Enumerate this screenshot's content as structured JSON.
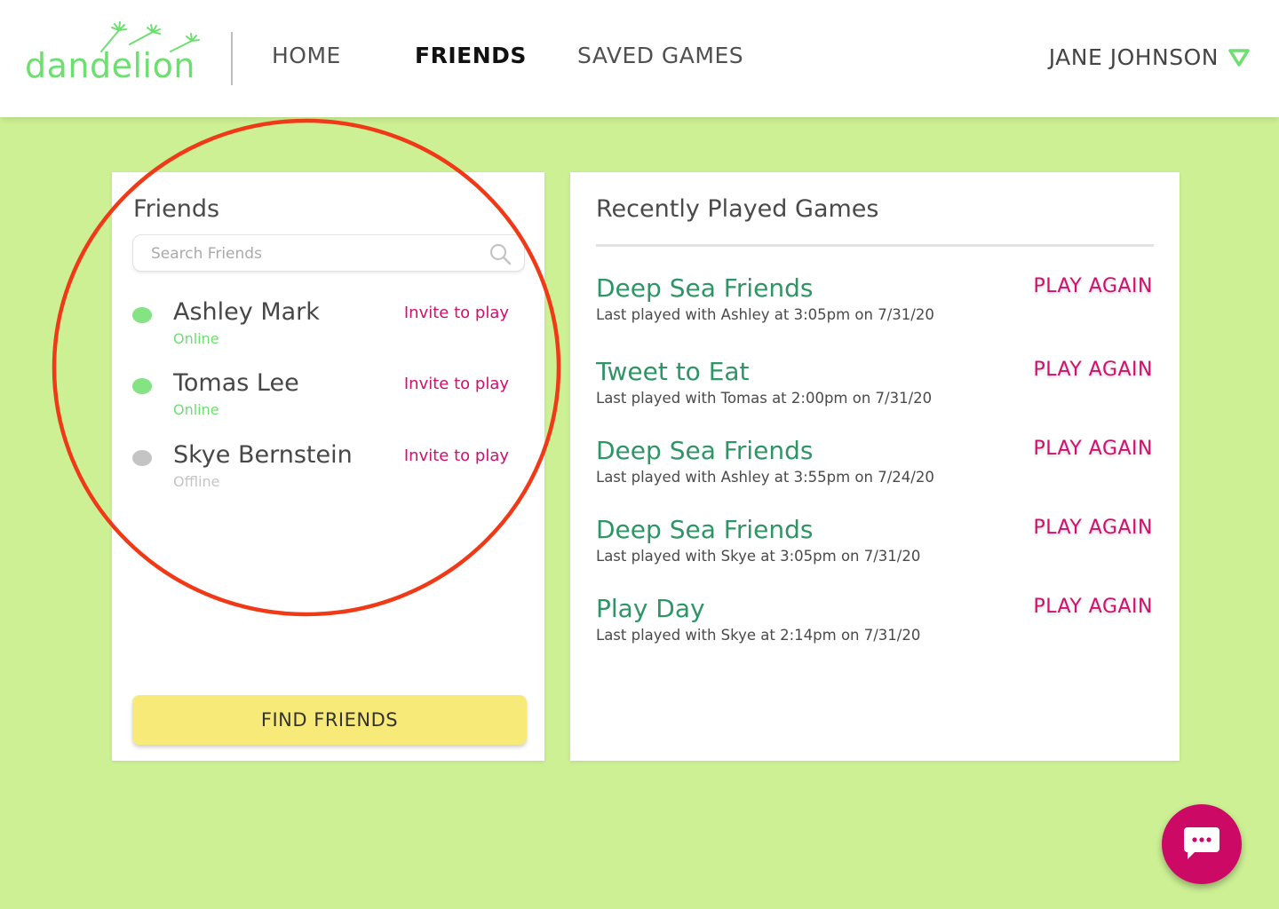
{
  "header": {
    "logo_text": "dandelion",
    "nav": [
      {
        "label": "HOME"
      },
      {
        "label": "FRIENDS"
      },
      {
        "label": "SAVED GAMES"
      }
    ],
    "user_name": "JANE JOHNSON"
  },
  "friends": {
    "title": "Friends",
    "search_placeholder": "Search Friends",
    "list": [
      {
        "name": "Ashley Mark",
        "status": "Online",
        "invite_label": "Invite to play"
      },
      {
        "name": "Tomas Lee",
        "status": "Online",
        "invite_label": "Invite to play"
      },
      {
        "name": "Skye Bernstein",
        "status": "Offline",
        "invite_label": "Invite to play"
      }
    ],
    "find_button_label": "FIND FRIENDS"
  },
  "games": {
    "title": "Recently Played Games",
    "list": [
      {
        "name": "Deep Sea Friends",
        "meta": "Last played with Ashley at 3:05pm on 7/31/20",
        "action": "PLAY AGAIN"
      },
      {
        "name": "Tweet to Eat",
        "meta": "Last played with Tomas at 2:00pm on 7/31/20",
        "action": "PLAY AGAIN"
      },
      {
        "name": "Deep Sea Friends",
        "meta": "Last played with Ashley at 3:55pm on 7/24/20",
        "action": "PLAY AGAIN"
      },
      {
        "name": "Deep Sea Friends",
        "meta": "Last played with Skye at 3:05pm on 7/31/20",
        "action": "PLAY AGAIN"
      },
      {
        "name": "Play Day",
        "meta": "Last played with Skye at 2:14pm on 7/31/20",
        "action": "PLAY AGAIN"
      }
    ]
  },
  "colors": {
    "background": "#cdf094",
    "brand_green": "#6ddf71",
    "online": "#84e383",
    "offline": "#c4c4c4",
    "accent_pink": "#d0106d",
    "game_green": "#2f9466",
    "button_yellow": "#f7ea78",
    "annotation_red": "#f03a17"
  },
  "icons": {
    "search": "search-icon",
    "caret": "caret-down-icon",
    "chat": "chat-bubble-icon",
    "status": "status-dot"
  }
}
